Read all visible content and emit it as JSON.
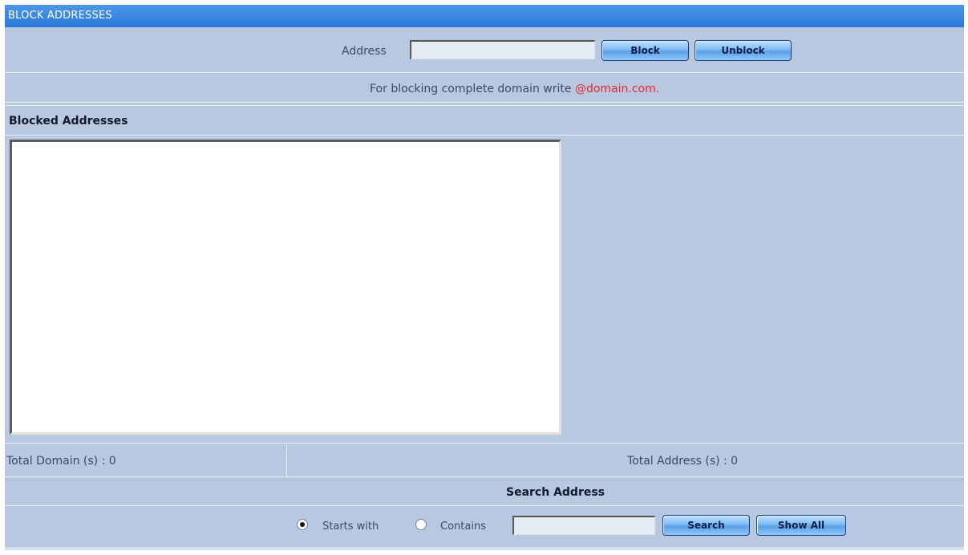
{
  "panel": {
    "title": "BLOCK ADDRESSES"
  },
  "address_form": {
    "label": "Address",
    "value": "",
    "block_label": "Block",
    "unblock_label": "Unblock"
  },
  "hint": {
    "text": "For blocking complete domain write ",
    "domain": "@domain.com."
  },
  "blocked": {
    "heading": "Blocked Addresses",
    "items": []
  },
  "totals": {
    "domains": "Total Domain (s) : 0",
    "addresses": "Total Address (s) : 0"
  },
  "search": {
    "heading": "Search Address",
    "mode_starts_with": "Starts with",
    "mode_contains": "Contains",
    "selected_mode": "starts_with",
    "value": "",
    "search_label": "Search",
    "show_all_label": "Show All"
  },
  "colors": {
    "titlebar": "#2a78db",
    "panel_bg": "#b8c8e0",
    "hint_accent": "#e8252b"
  }
}
